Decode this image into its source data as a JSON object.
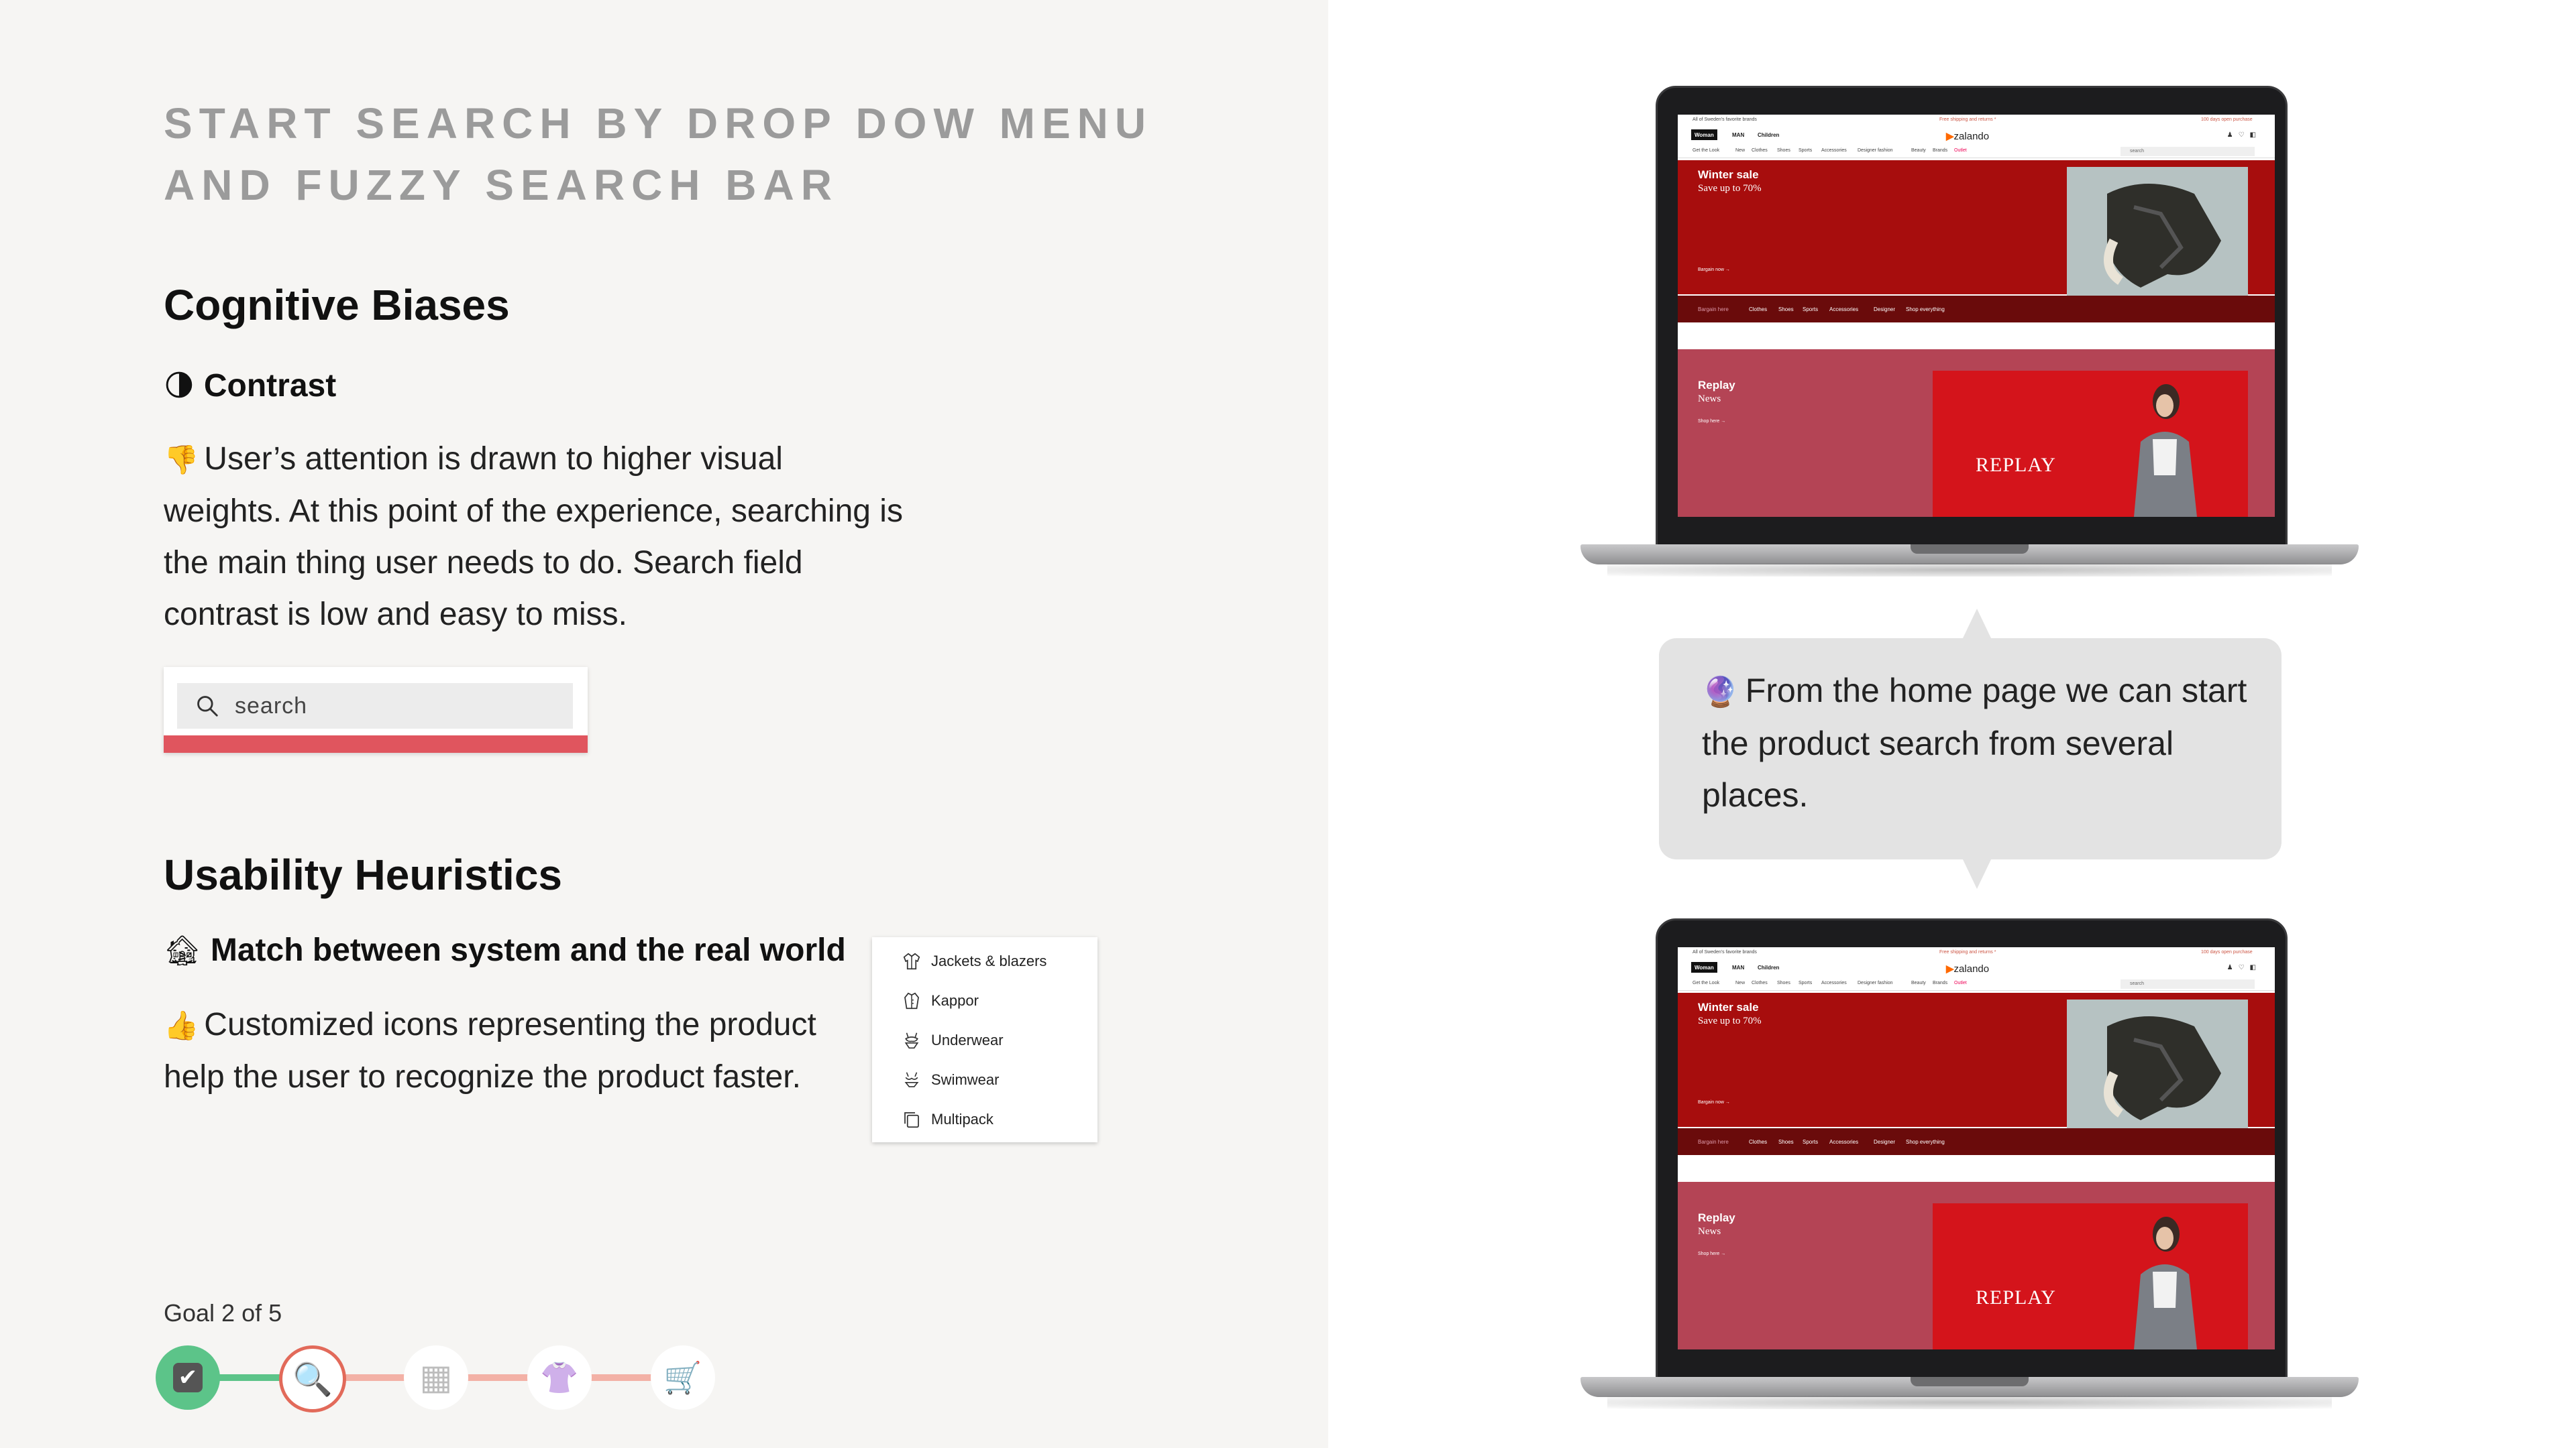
{
  "slide": {
    "title": "START SEARCH BY DROP DOW MENU AND FUZZY SEARCH BAR"
  },
  "cognitive": {
    "heading": "Cognitive Biases",
    "principle": "Contrast",
    "principle_emoji": "🌗",
    "text_emoji": "👎",
    "text": "User’s attention is drawn to higher visual weights. At this point of the experience, searching is the main thing user needs to do. Search field contrast is low and easy to miss.",
    "search_placeholder": "search"
  },
  "heuristics": {
    "heading": "Usability Heuristics",
    "principle": "Match between system and the real world",
    "principle_emoji": "🏚",
    "text_emoji": "👍",
    "text": "Customized icons representing the product help the user to recognize the product faster.",
    "menu": [
      "Jackets & blazers",
      "Kappor",
      "Underwear",
      "Swimwear",
      "Multipack"
    ]
  },
  "goal": {
    "label": "Goal 2 of 5",
    "steps": [
      {
        "icon": "check-icon",
        "glyph": "✔",
        "state": "done"
      },
      {
        "icon": "magnifier-icon",
        "glyph": "🔍",
        "state": "current"
      },
      {
        "icon": "grid-icon",
        "glyph": "▦",
        "state": "todo"
      },
      {
        "icon": "shirt-icon",
        "glyph": "👚",
        "state": "todo"
      },
      {
        "icon": "cart-icon",
        "glyph": "🛒",
        "state": "todo"
      }
    ],
    "colors": {
      "done": "#5cc489",
      "current": "#e26a5a",
      "track_todo": "#f3b1a6"
    }
  },
  "bubble": {
    "emoji": "🔮",
    "text": "From the home page we can start the product search from several places."
  },
  "zalando": {
    "promo_left": "All of Sweden's favorite brands",
    "promo_mid": "Free shipping and returns *",
    "promo_right": "100 days open purchase",
    "tabs": [
      "Woman",
      "MAN",
      "Children"
    ],
    "logo": "zalando",
    "categories": [
      "Get the Look",
      "New",
      "Clothes",
      "Shoes",
      "Sports",
      "Accessories",
      "Designer fashion",
      "Beauty",
      "Brands",
      "Outlet"
    ],
    "search_placeholder": "search",
    "hero_title": "Winter sale",
    "hero_subtitle": "Save up to 70%",
    "hero_cta": "Bargain now →",
    "band_items": [
      "Bargain here",
      "Clothes",
      "Shoes",
      "Sports",
      "Accessories",
      "Designer",
      "Shop everything"
    ],
    "replay_title": "Replay",
    "replay_subtitle": "News",
    "replay_cta": "Shop here →",
    "replay_brand": "REPLAY"
  }
}
